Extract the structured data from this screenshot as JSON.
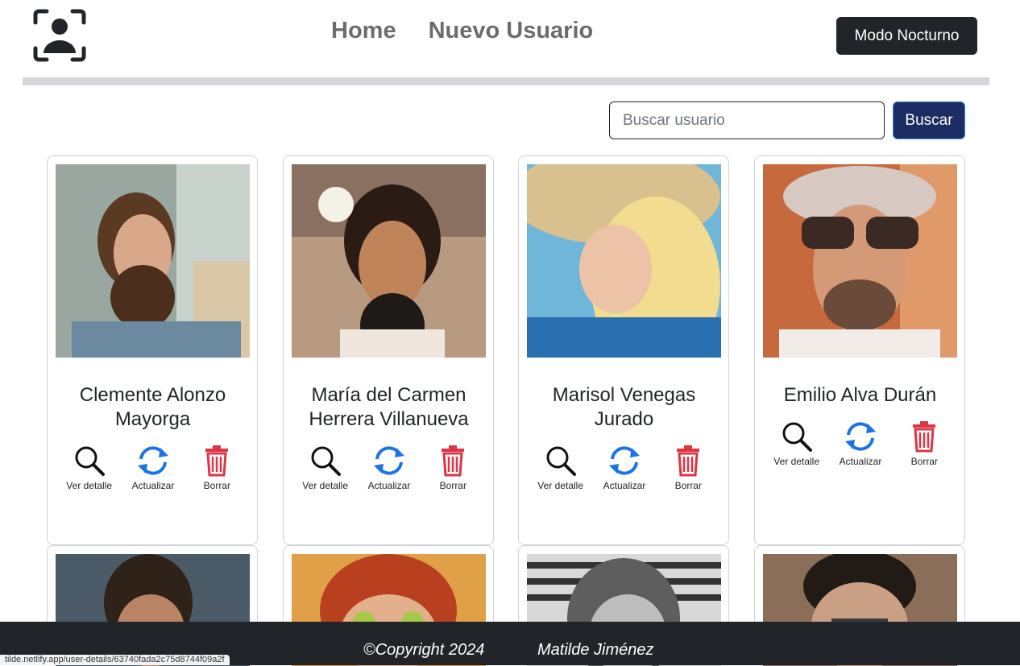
{
  "nav": {
    "home": "Home",
    "new_user": "Nuevo Usuario",
    "night_mode": "Modo Nocturno"
  },
  "search": {
    "placeholder": "Buscar usuario",
    "button": "Buscar"
  },
  "actions": {
    "view": "Ver detalle",
    "update": "Actualizar",
    "delete": "Borrar"
  },
  "users": [
    {
      "name": "Clemente Alonzo Mayorga"
    },
    {
      "name": "María del Carmen Herrera Villanueva"
    },
    {
      "name": "Marisol Venegas Jurado"
    },
    {
      "name": "Emilio Alva Durán"
    }
  ],
  "footer": {
    "copyright": "©Copyright 2024",
    "author": "Matilde Jiménez"
  },
  "status_url": "tilde.netlify.app/user-details/63740fada2c75d8744f09a2f",
  "colors": {
    "dark": "#212529",
    "search_button": "#1c2d63",
    "update_icon": "#1a73e8",
    "delete_icon": "#dc3545"
  }
}
